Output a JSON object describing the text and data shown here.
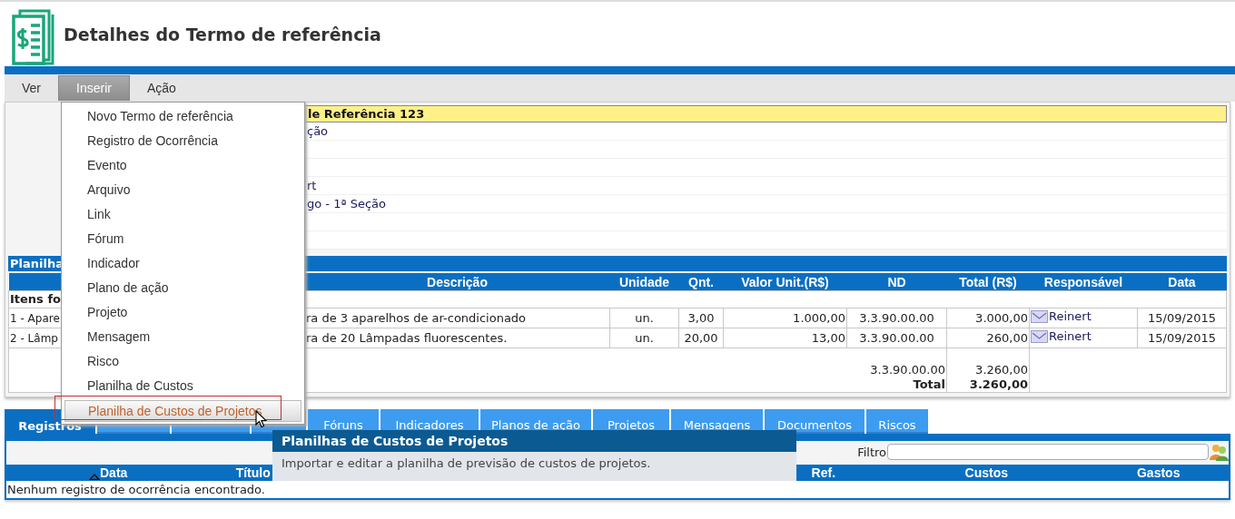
{
  "page": {
    "title": "Detalhes do Termo de referência"
  },
  "menu_bar": [
    {
      "label": "Ver",
      "selected": false
    },
    {
      "label": "Inserir",
      "selected": true
    },
    {
      "label": "Ação",
      "selected": false
    }
  ],
  "details": {
    "rows": [
      {
        "value": "le Referência 123",
        "kind": "header"
      },
      {
        "value": "ção",
        "kind": "plain"
      },
      {
        "kind": "plain"
      },
      {
        "kind": "plain"
      },
      {
        "value": "rt",
        "kind": "plain"
      },
      {
        "value": "go - 1ª Seção",
        "kind": "plain"
      },
      {
        "kind": "plain"
      },
      {
        "kind": "plain"
      }
    ]
  },
  "cost_sheet": {
    "title": "Planilha",
    "columns": [
      "Descrição",
      "Unidade",
      "Qnt.",
      "Valor Unit.(R$)",
      "ND",
      "Total (R$)",
      "Responsável",
      "Data"
    ],
    "group": "Itens fo",
    "rows": [
      {
        "item": "1 - Apare",
        "description": "ra de 3 aparelhos de ar-condicionado",
        "unit": "un.",
        "qty": "3,00",
        "unit_value": "1.000,00",
        "nd": "3.3.90.00.00",
        "total": "3.000,00",
        "owner": "Reinert",
        "date": "15/09/2015"
      },
      {
        "item": "2 - Lâmp",
        "description": "ra de 20 Lâmpadas fluorescentes.",
        "unit": "un.",
        "qty": "20,00",
        "unit_value": "13,00",
        "nd": "3.3.90.00.00",
        "total": "260,00",
        "owner": "Reinert",
        "date": "15/09/2015"
      }
    ],
    "summary": {
      "nd": "3.3.90.00.00",
      "nd_total": "3.260,00",
      "total_label": "Total",
      "total": "3.260,00"
    }
  },
  "insert_menu": {
    "items": [
      {
        "label": "Novo Termo de referência",
        "selected": false
      },
      {
        "label": "Registro de Ocorrência",
        "selected": false
      },
      {
        "label": "Evento",
        "selected": false
      },
      {
        "label": "Arquivo",
        "selected": false
      },
      {
        "label": "Link",
        "selected": false
      },
      {
        "label": "Fórum",
        "selected": false
      },
      {
        "label": "Indicador",
        "selected": false
      },
      {
        "label": "Plano de ação",
        "selected": false
      },
      {
        "label": "Projeto",
        "selected": false
      },
      {
        "label": "Mensagem",
        "selected": false
      },
      {
        "label": "Risco",
        "selected": false
      },
      {
        "label": "Planilha de Custos",
        "selected": false
      },
      {
        "label": "Planilha de Custos de Projetos",
        "selected": true
      }
    ]
  },
  "tabs": [
    {
      "label": "Registros",
      "selected": true
    },
    {
      "selected": false
    },
    {
      "selected": false
    },
    {
      "selected": false
    },
    {
      "label": "Fóruns",
      "selected": false
    },
    {
      "label": "Indicadores",
      "selected": false
    },
    {
      "label": "Planos de ação",
      "selected": false
    },
    {
      "label": "Projetos",
      "selected": false
    },
    {
      "label": "Mensagens",
      "selected": false
    },
    {
      "label": "Documentos",
      "selected": false
    },
    {
      "label": "Riscos",
      "selected": false
    }
  ],
  "filter": {
    "label": "Filtro"
  },
  "records_table": {
    "columns": [
      {
        "label": "Data",
        "sorted": true
      },
      {
        "label": "Título",
        "sorted": false
      },
      {},
      {},
      {
        "label": "Ref.",
        "sorted": false
      },
      {
        "label": "Custos",
        "sorted": false
      },
      {
        "label": "Gastos",
        "sorted": false
      }
    ],
    "empty_message": "Nenhum registro de ocorrência encontrado."
  },
  "tooltip": {
    "title": "Planilhas de Custos de Projetos",
    "text": "Importar e editar a planilha de previsão de custos de projetos."
  }
}
